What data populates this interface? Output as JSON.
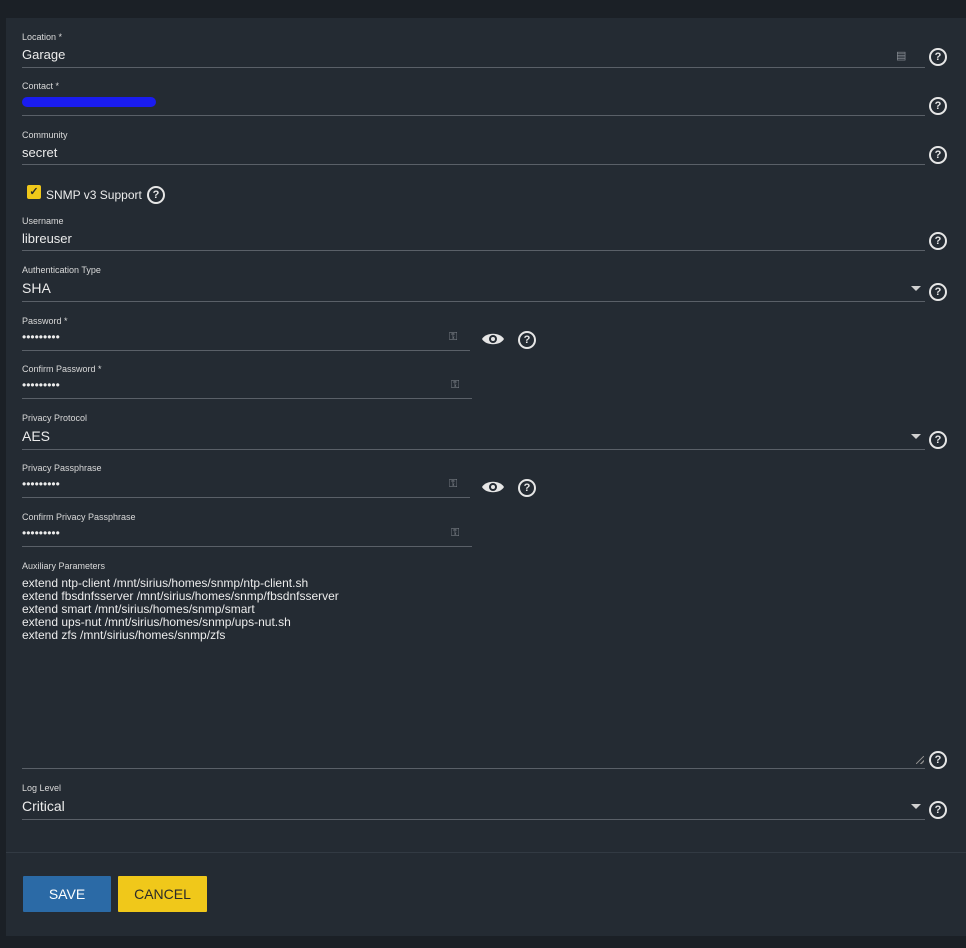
{
  "form": {
    "location": {
      "label": "Location *",
      "value": "Garage"
    },
    "contact": {
      "label": "Contact *",
      "value": ""
    },
    "community": {
      "label": "Community",
      "value": "secret"
    },
    "snmp_v3": {
      "label": "SNMP v3 Support",
      "checked": true
    },
    "username": {
      "label": "Username",
      "value": "libreuser"
    },
    "auth_type": {
      "label": "Authentication Type",
      "value": "SHA"
    },
    "password": {
      "label": "Password *",
      "value": "•••••••••"
    },
    "confirm_password": {
      "label": "Confirm Password *",
      "value": "•••••••••"
    },
    "privacy_protocol": {
      "label": "Privacy Protocol",
      "value": "AES"
    },
    "privacy_passphrase": {
      "label": "Privacy Passphrase",
      "value": "•••••••••"
    },
    "confirm_privacy_passphrase": {
      "label": "Confirm Privacy Passphrase",
      "value": "•••••••••"
    },
    "aux_params": {
      "label": "Auxiliary Parameters",
      "value": "extend ntp-client /mnt/sirius/homes/snmp/ntp-client.sh\nextend fbsdnfsserver /mnt/sirius/homes/snmp/fbsdnfsserver\nextend smart /mnt/sirius/homes/snmp/smart\nextend ups-nut /mnt/sirius/homes/snmp/ups-nut.sh\nextend zfs /mnt/sirius/homes/snmp/zfs"
    },
    "log_level": {
      "label": "Log Level",
      "value": "Critical"
    }
  },
  "buttons": {
    "save": "SAVE",
    "cancel": "CANCEL"
  },
  "icons": {
    "help": "?",
    "checkmark": "✓",
    "key": "⚿"
  },
  "colors": {
    "accent_yellow": "#f0c81a",
    "primary_blue": "#2b6aa6",
    "panel_bg": "#242b33"
  }
}
